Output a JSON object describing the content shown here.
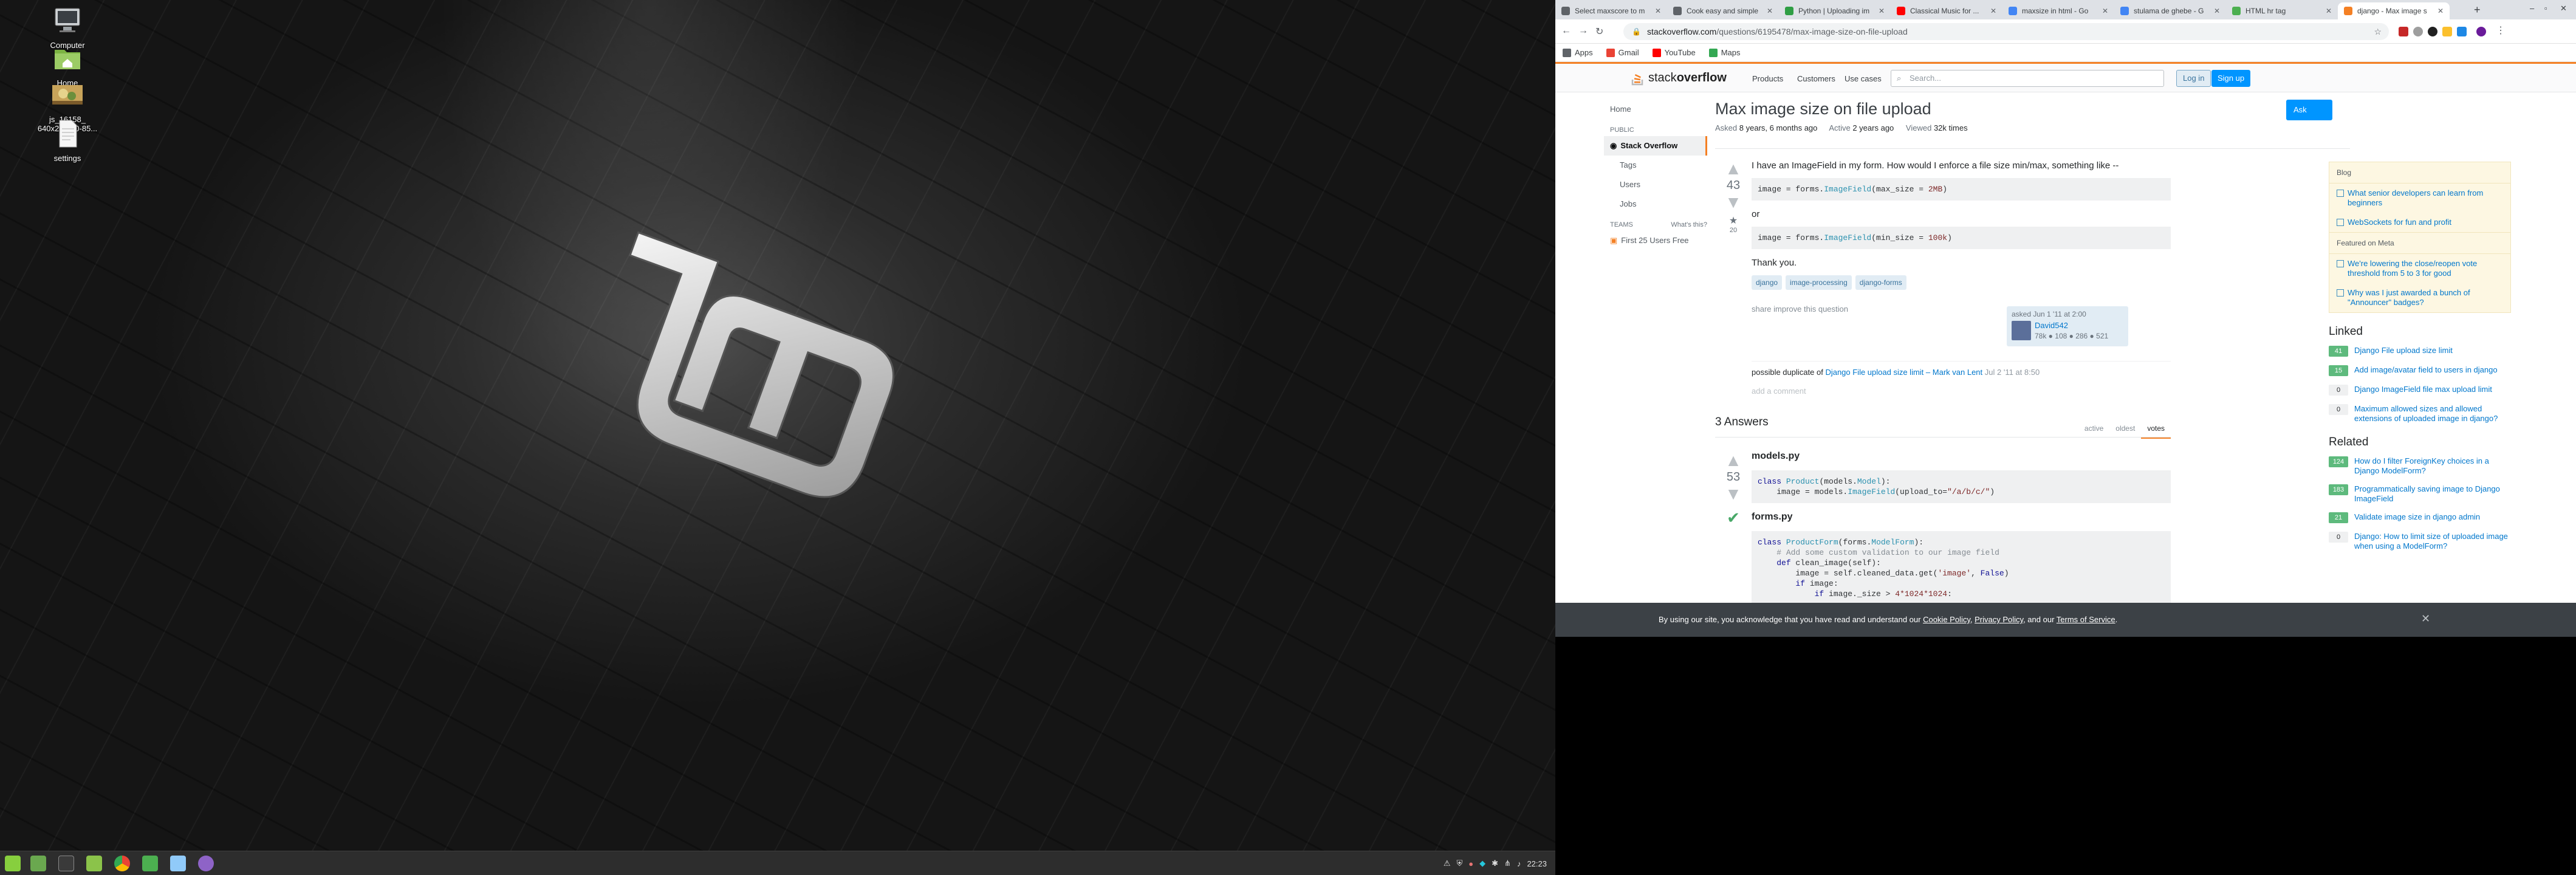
{
  "desktop": {
    "icons": [
      {
        "label": "Computer"
      },
      {
        "label": "Home"
      },
      {
        "label": "js_16158_\n640x292-10-85..."
      },
      {
        "label": "settings"
      }
    ],
    "clock": "22:23"
  },
  "browser": {
    "tabs": [
      {
        "title": "Select maxscore to m",
        "color": "#5f6368"
      },
      {
        "title": "Cook easy and simple",
        "color": "#5f6368"
      },
      {
        "title": "Python | Uploading im",
        "color": "#2f9e44"
      },
      {
        "title": "Classical Music for ...",
        "color": "#ff0000"
      },
      {
        "title": "maxsize in html - Go",
        "color": "#4285f4"
      },
      {
        "title": "stulama de ghebe - G",
        "color": "#4285f4"
      },
      {
        "title": "HTML hr tag",
        "color": "#4caf50"
      },
      {
        "title": "django - Max image s",
        "color": "#f48024"
      }
    ],
    "url_host": "stackoverflow.com",
    "url_path": "/questions/6195478/max-image-size-on-file-upload",
    "bookmarks": [
      {
        "label": "Apps",
        "color": "#5f6368"
      },
      {
        "label": "Gmail",
        "color": "#ea4335"
      },
      {
        "label": "YouTube",
        "color": "#ff0000"
      },
      {
        "label": "Maps",
        "color": "#34a853"
      }
    ]
  },
  "so": {
    "logo_a": "stack",
    "logo_b": "overflow",
    "nav": {
      "products": "Products",
      "customers": "Customers",
      "use_cases": "Use cases"
    },
    "search_placeholder": "Search...",
    "login": "Log in",
    "signup": "Sign up",
    "leftnav": {
      "home": "Home",
      "public": "PUBLIC",
      "stack_overflow": "Stack Overflow",
      "tags": "Tags",
      "users": "Users",
      "jobs": "Jobs",
      "teams": "TEAMS",
      "whats_this": "What's this?",
      "first25": "First 25 Users Free"
    },
    "question": {
      "title": "Max image size on file upload",
      "ask_button": "Ask Question",
      "asked_label": "Asked",
      "asked_value": "8 years, 6 months ago",
      "active_label": "Active",
      "active_value": "2 years ago",
      "viewed_label": "Viewed",
      "viewed_value": "32k times",
      "votes": "43",
      "favorites": "20",
      "p1": "I have an ImageField in my form. How would I enforce a file size min/max, something like --",
      "or": "or",
      "thanks": "Thank you.",
      "tags": [
        "django",
        "image-processing",
        "django-forms"
      ],
      "share": "share",
      "improve": "improve this question",
      "asked_when": "asked Jun 1 '11 at 2:00",
      "user": "David542",
      "rep": "78k ● 108 ● 286 ● 521",
      "comment_pre": "possible duplicate of",
      "comment_link": "Django File upload size limit",
      "comment_author": "– Mark van Lent",
      "comment_date": "Jul 2 '11 at 8:50",
      "add_comment": "add a comment"
    },
    "answers": {
      "count_label": "3 Answers",
      "sort": [
        "active",
        "oldest",
        "votes"
      ],
      "votes": "53",
      "h1": "models.py",
      "h2": "forms.py"
    },
    "sidebar": {
      "blog_head": "Blog",
      "blog_items": [
        "What senior developers can learn from beginners",
        "WebSockets for fun and profit"
      ],
      "meta_head": "Featured on Meta",
      "meta_items": [
        "We're lowering the close/reopen vote threshold from 5 to 3 for good",
        "Why was I just awarded a bunch of \"Announcer\" badges?"
      ],
      "linked_head": "Linked",
      "linked": [
        {
          "score": "41",
          "text": "Django File upload size limit",
          "green": true
        },
        {
          "score": "15",
          "text": "Add image/avatar field to users in django",
          "green": true
        },
        {
          "score": "0",
          "text": "Django ImageField file max upload limit",
          "green": false
        },
        {
          "score": "0",
          "text": "Maximum allowed sizes and allowed extensions of uploaded image in django?",
          "green": false
        }
      ],
      "related_head": "Related",
      "related": [
        {
          "score": "124",
          "text": "How do I filter ForeignKey choices in a Django ModelForm?",
          "green": true
        },
        {
          "score": "183",
          "text": "Programmatically saving image to Django ImageField",
          "green": true
        },
        {
          "score": "21",
          "text": "Validate image size in django admin",
          "green": true
        },
        {
          "score": "0",
          "text": "Django: How to limit size of uploaded image when using a ModelForm?",
          "green": false
        }
      ]
    },
    "cookie": {
      "pre": "By using our site, you acknowledge that you have read and understand our",
      "cookie_policy": "Cookie Policy",
      "sep1": ",",
      "privacy": "Privacy Policy",
      "sep2": ", and our",
      "terms": "Terms of Service",
      "end": "."
    }
  }
}
